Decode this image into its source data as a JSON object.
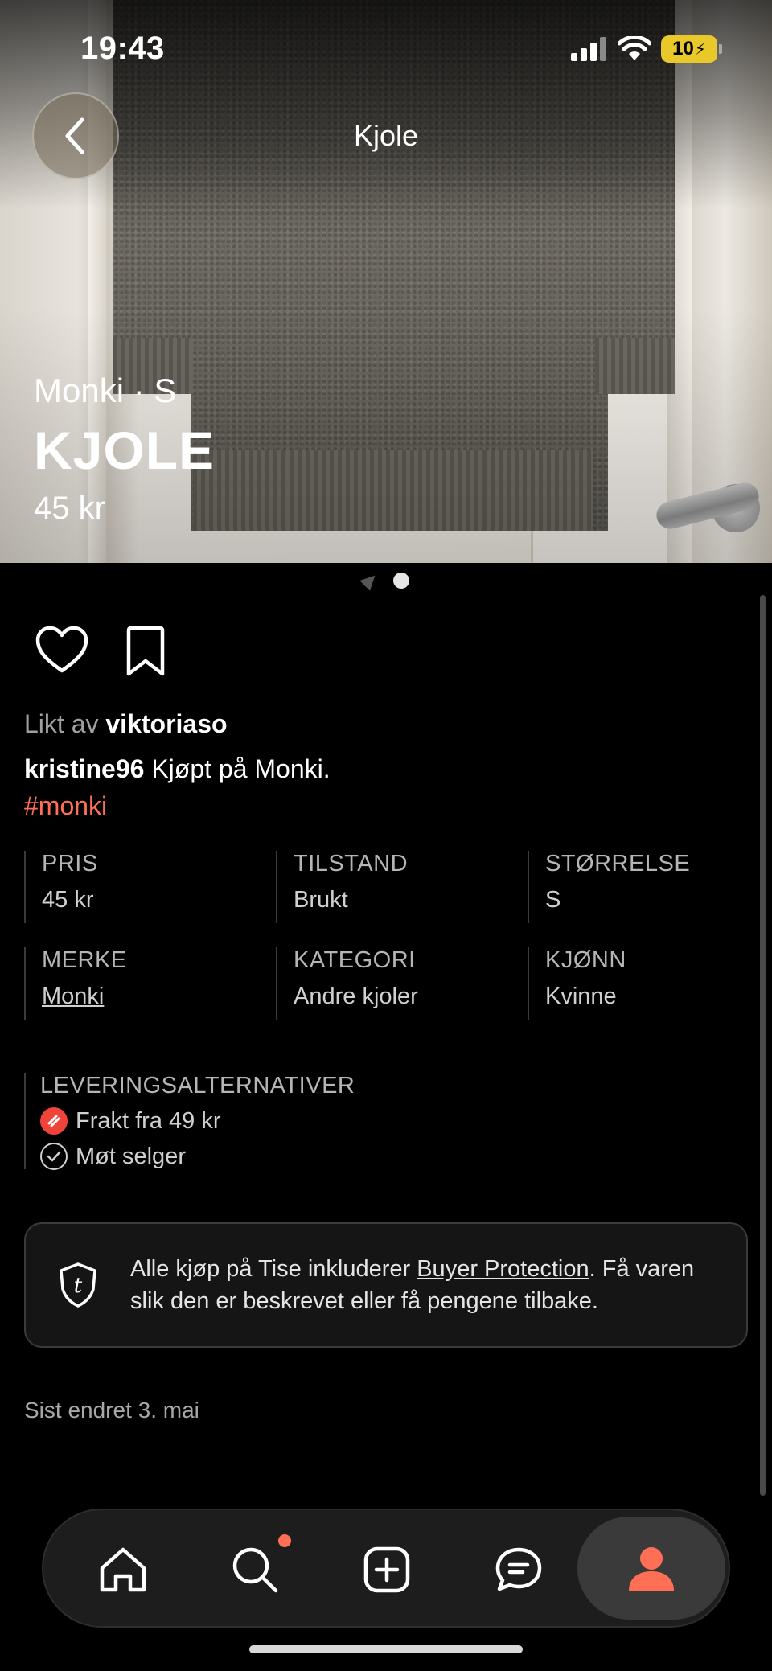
{
  "status_bar": {
    "time": "19:43",
    "battery": "10"
  },
  "nav": {
    "title": "Kjole"
  },
  "hero": {
    "brand_size": "Monki · S",
    "title": "KJOLE",
    "price": "45 kr"
  },
  "social": {
    "liked_prefix": "Likt av",
    "liked_user": "viktoriaso",
    "seller": "kristine96",
    "description": "Kjøpt på Monki.",
    "hashtag": "#monki"
  },
  "attributes": [
    {
      "label": "PRIS",
      "value": "45 kr"
    },
    {
      "label": "TILSTAND",
      "value": "Brukt"
    },
    {
      "label": "STØRRELSE",
      "value": "S"
    },
    {
      "label": "MERKE",
      "value": "Monki"
    },
    {
      "label": "KATEGORI",
      "value": "Andre kjoler"
    },
    {
      "label": "KJØNN",
      "value": "Kvinne"
    }
  ],
  "delivery": {
    "label": "LEVERINGSALTERNATIVER",
    "shipping": "Frakt fra 49 kr",
    "meet": "Møt selger"
  },
  "protection": {
    "text_before": "Alle kjøp på Tise inkluderer ",
    "link": "Buyer Protection",
    "text_after": ". Få varen slik den er beskrevet eller få pengene tilbake."
  },
  "last_changed": "Sist endret 3. mai",
  "tabbar": {
    "items": [
      {
        "icon": "home-icon"
      },
      {
        "icon": "search-icon"
      },
      {
        "icon": "add-icon"
      },
      {
        "icon": "chat-icon"
      },
      {
        "icon": "profile-icon"
      }
    ],
    "accent": "#ff6f55"
  }
}
